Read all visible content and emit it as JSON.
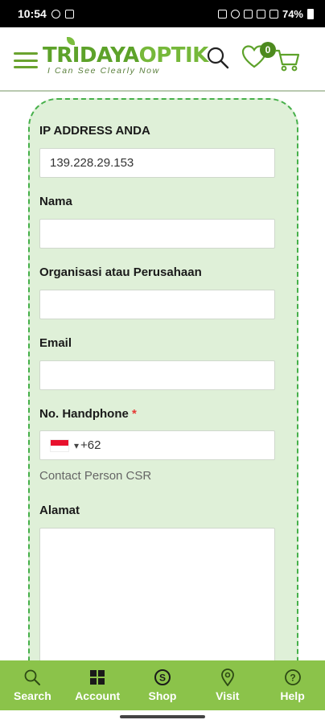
{
  "status_bar": {
    "time": "10:54",
    "battery": "74%"
  },
  "header": {
    "logo_main": "TRIDAYA",
    "logo_accent": "OPTIK",
    "tagline": "I Can See Clearly Now",
    "wishlist_count": "0"
  },
  "form": {
    "ip_label": "IP ADDRESS ANDA",
    "ip_value": "139.228.29.153",
    "name_label": "Nama",
    "org_label": "Organisasi atau Perusahaan",
    "email_label": "Email",
    "phone_label": "No. Handphone",
    "phone_required": "*",
    "phone_value": "+62",
    "phone_country": "ID",
    "phone_helper": "Contact Person CSR",
    "address_label": "Alamat"
  },
  "bottom_nav": {
    "items": [
      {
        "label": "Search",
        "icon": "search-icon"
      },
      {
        "label": "Account",
        "icon": "windows-icon"
      },
      {
        "label": "Shop",
        "icon": "skype-icon"
      },
      {
        "label": "Visit",
        "icon": "map-pin-icon"
      },
      {
        "label": "Help",
        "icon": "help-icon"
      }
    ]
  },
  "colors": {
    "brand_green": "#5da22a",
    "nav_green": "#8bc34a",
    "form_bg": "#dff0d8",
    "form_border": "#46b04a"
  }
}
